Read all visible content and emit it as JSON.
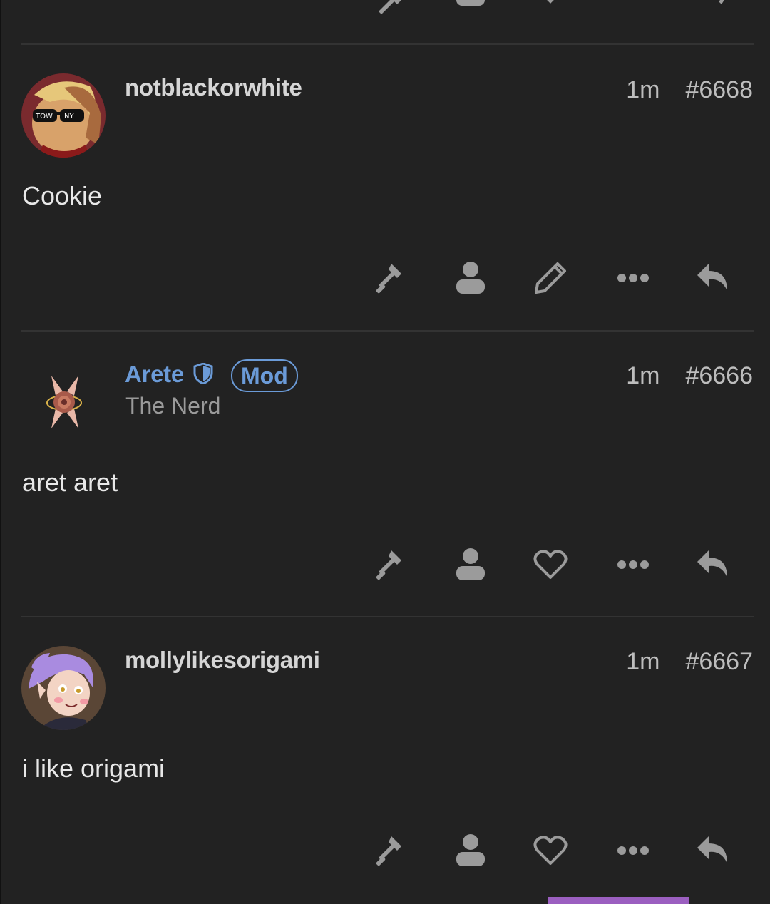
{
  "posts": [
    {
      "username": "notblackorwhite",
      "time": "1m",
      "number": "#6668",
      "body": "Cookie",
      "actions": [
        "gavel-icon",
        "user-icon",
        "edit-icon",
        "more-icon",
        "reply-icon"
      ]
    },
    {
      "username": "Arete",
      "badge": "Mod",
      "user_title": "The Nerd",
      "time": "1m",
      "number": "#6666",
      "body": "aret aret",
      "actions": [
        "gavel-icon",
        "user-icon",
        "heart-icon",
        "more-icon",
        "reply-icon"
      ]
    },
    {
      "username": "mollylikesorigami",
      "time": "1m",
      "number": "#6667",
      "body": "i like origami",
      "actions": [
        "gavel-icon",
        "user-icon",
        "heart-icon",
        "more-icon",
        "reply-icon"
      ]
    }
  ],
  "colors": {
    "background": "#222222",
    "mod_accent": "#6b9bd8",
    "icon": "#9b9b9b",
    "bottom_indicator": "#9b5fc0"
  }
}
